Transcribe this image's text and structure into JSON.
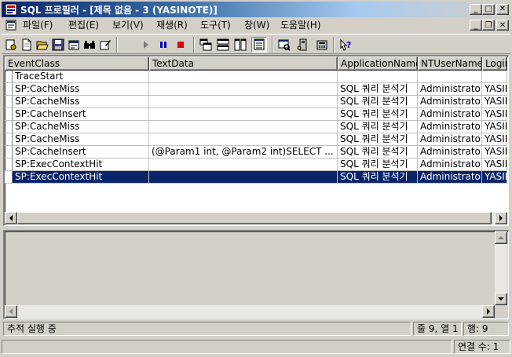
{
  "window": {
    "title": "SQL 프로필러 - [제목 없음 - 3 (YASINOTE)]",
    "minimize_glyph": "_",
    "maximize_glyph": "□",
    "close_glyph": "✕",
    "restore_glyph": "❐"
  },
  "menu": [
    {
      "label": "파일(F)"
    },
    {
      "label": "편집(E)"
    },
    {
      "label": "보기(V)"
    },
    {
      "label": "재생(R)"
    },
    {
      "label": "도구(T)"
    },
    {
      "label": "창(W)"
    },
    {
      "label": "도움말(H)"
    }
  ],
  "toolbar": {
    "icons": [
      "properties-icon",
      "new-trace-icon",
      "open-folder-icon",
      "save-icon",
      "trace-properties-icon",
      "find-icon",
      "edit-icon",
      "play-icon",
      "pause-icon",
      "stop-icon",
      "cascade-windows-icon",
      "tile-horizontal-icon",
      "tile-vertical-icon",
      "auto-scroll-icon",
      "query-analyzer-icon",
      "enterprise-manager-icon",
      "settings-icon",
      "help-icon"
    ]
  },
  "grid": {
    "columns": [
      "EventClass",
      "TextData",
      "ApplicationName",
      "NTUserName",
      "LoginName"
    ],
    "rows": [
      {
        "event": "TraceStart",
        "text": "",
        "app": "",
        "user": "",
        "login": ""
      },
      {
        "event": "SP:CacheMiss",
        "text": "",
        "app": "SQL 쿼리 분석기",
        "user": "Administrator",
        "login": "YASINOTE"
      },
      {
        "event": "SP:CacheMiss",
        "text": "",
        "app": "SQL 쿼리 분석기",
        "user": "Administrator",
        "login": "YASINOTE"
      },
      {
        "event": "SP:CacheInsert",
        "text": "",
        "app": "SQL 쿼리 분석기",
        "user": "Administrator",
        "login": "YASINOTE"
      },
      {
        "event": "SP:CacheMiss",
        "text": "",
        "app": "SQL 쿼리 분석기",
        "user": "Administrator",
        "login": "YASINOTE"
      },
      {
        "event": "SP:CacheMiss",
        "text": "",
        "app": "SQL 쿼리 분석기",
        "user": "Administrator",
        "login": "YASINOTE"
      },
      {
        "event": "SP:CacheInsert",
        "text": "(@Param1 int, @Param2 int)SELECT ...",
        "app": "SQL 쿼리 분석기",
        "user": "Administrator",
        "login": "YASINOTE"
      },
      {
        "event": "SP:ExecContextHit",
        "text": "",
        "app": "SQL 쿼리 분석기",
        "user": "Administrator",
        "login": "YASINOTE"
      },
      {
        "event": "SP:ExecContextHit",
        "text": "",
        "app": "SQL 쿼리 분석기",
        "user": "Administrator",
        "login": "YASINOTE"
      }
    ],
    "selected_row_index": 8
  },
  "status": {
    "message": "추적 실행 중",
    "position": "줄 9, 열 1",
    "rows": "행: 9",
    "connections": "연결 수: 1"
  },
  "colors": {
    "selection": "#0a246a",
    "face": "#d4d0c8"
  }
}
